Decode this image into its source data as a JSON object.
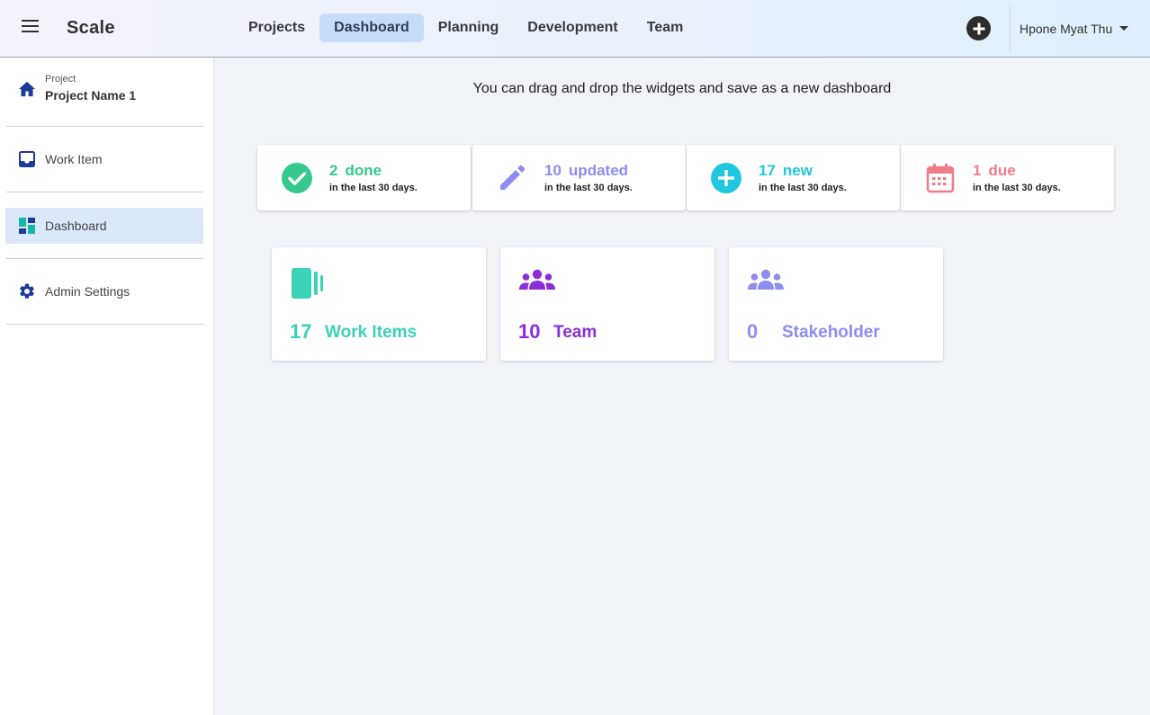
{
  "header": {
    "brand": "Scale",
    "nav": [
      "Projects",
      "Dashboard",
      "Planning",
      "Development",
      "Team"
    ],
    "active_nav": "Dashboard",
    "user_name": "Hpone Myat Thu"
  },
  "sidebar": {
    "project_label": "Project",
    "project_name": "Project Name 1",
    "items": [
      {
        "label": "Work Item",
        "icon": "inbox-icon"
      },
      {
        "label": "Dashboard",
        "icon": "dashboard-icon",
        "active": true
      },
      {
        "label": "Admin Settings",
        "icon": "gear-icon"
      }
    ]
  },
  "main": {
    "hint": "You can drag and drop the widgets and save as a new dashboard",
    "stats": [
      {
        "num": "2",
        "label": "done",
        "sub": "in the last 30 days.",
        "color": "#35c98d",
        "icon": "check-circle-icon"
      },
      {
        "num": "10",
        "label": "updated",
        "sub": "in the last 30 days.",
        "color": "#8e8df0",
        "icon": "pencil-icon"
      },
      {
        "num": "17",
        "label": "new",
        "sub": "in the last 30 days.",
        "color": "#1fc8df",
        "icon": "plus-circle-icon"
      },
      {
        "num": "1",
        "label": "due",
        "sub": "in the last 30 days.",
        "color": "#f17c8a",
        "icon": "calendar-icon"
      }
    ],
    "cards": [
      {
        "num": "17",
        "label": "Work Items",
        "color": "#3ad3b7",
        "icon": "work-items-icon"
      },
      {
        "num": "10",
        "label": "Team",
        "color": "#8a2ed6",
        "icon": "team-icon"
      },
      {
        "num": "0",
        "label": "Stakeholder",
        "color": "#8d8df2",
        "icon": "stakeholder-icon"
      }
    ]
  }
}
